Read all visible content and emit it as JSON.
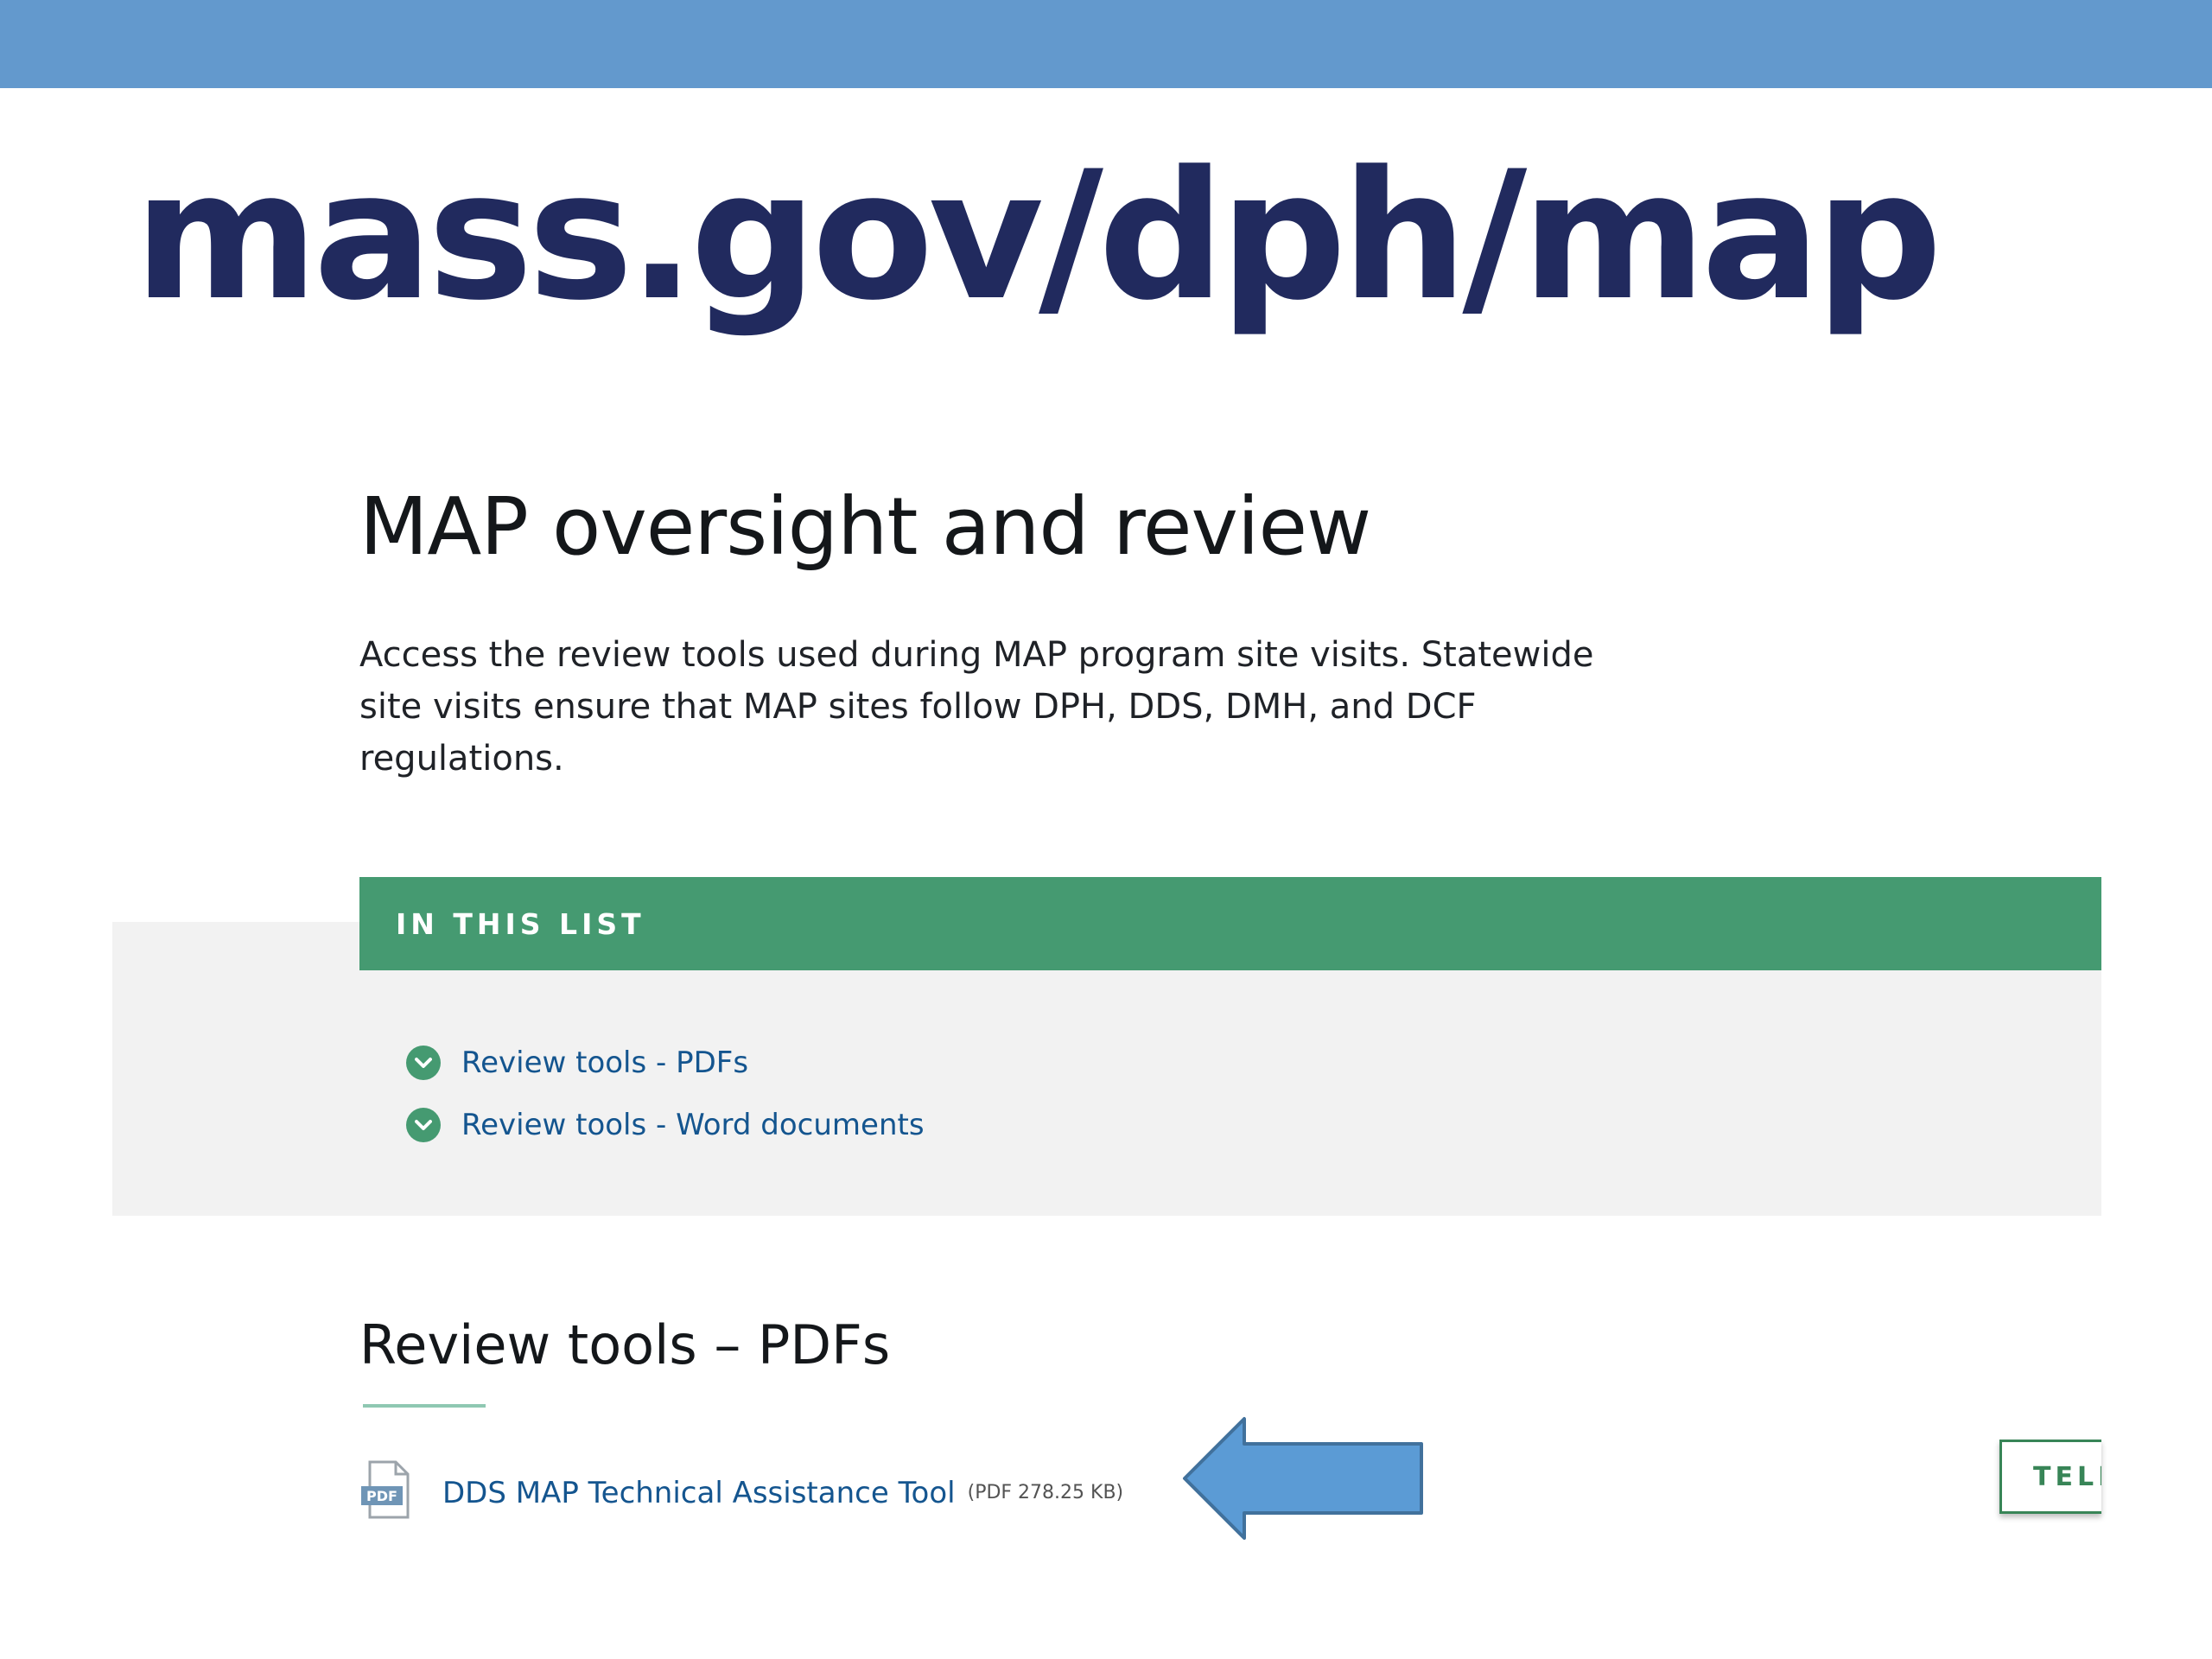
{
  "slide": {
    "title": "mass.gov/dph/map",
    "colors": {
      "bar": "#6399cd",
      "title": "#212a5e",
      "arrow": "#5b9bd5"
    }
  },
  "page": {
    "heading": "MAP oversight and review",
    "description": "Access the review tools used during MAP program site visits. Statewide site visits ensure that MAP sites follow DPH, DDS, DMH, and DCF regulations.",
    "in_this_list": {
      "header": "IN THIS LIST",
      "items": [
        {
          "label": "Review tools - PDFs",
          "icon": "chevron-down-circle-icon"
        },
        {
          "label": "Review tools - Word documents",
          "icon": "chevron-down-circle-icon"
        }
      ]
    },
    "section": {
      "heading": "Review tools – PDFs",
      "document": {
        "link": "DDS MAP Technical Assistance Tool",
        "meta": "(PDF 278.25 KB)",
        "icon": "pdf-file-icon"
      }
    },
    "tell_us_button": "TELL",
    "colors": {
      "green": "#459a71",
      "link": "#14558f"
    }
  }
}
